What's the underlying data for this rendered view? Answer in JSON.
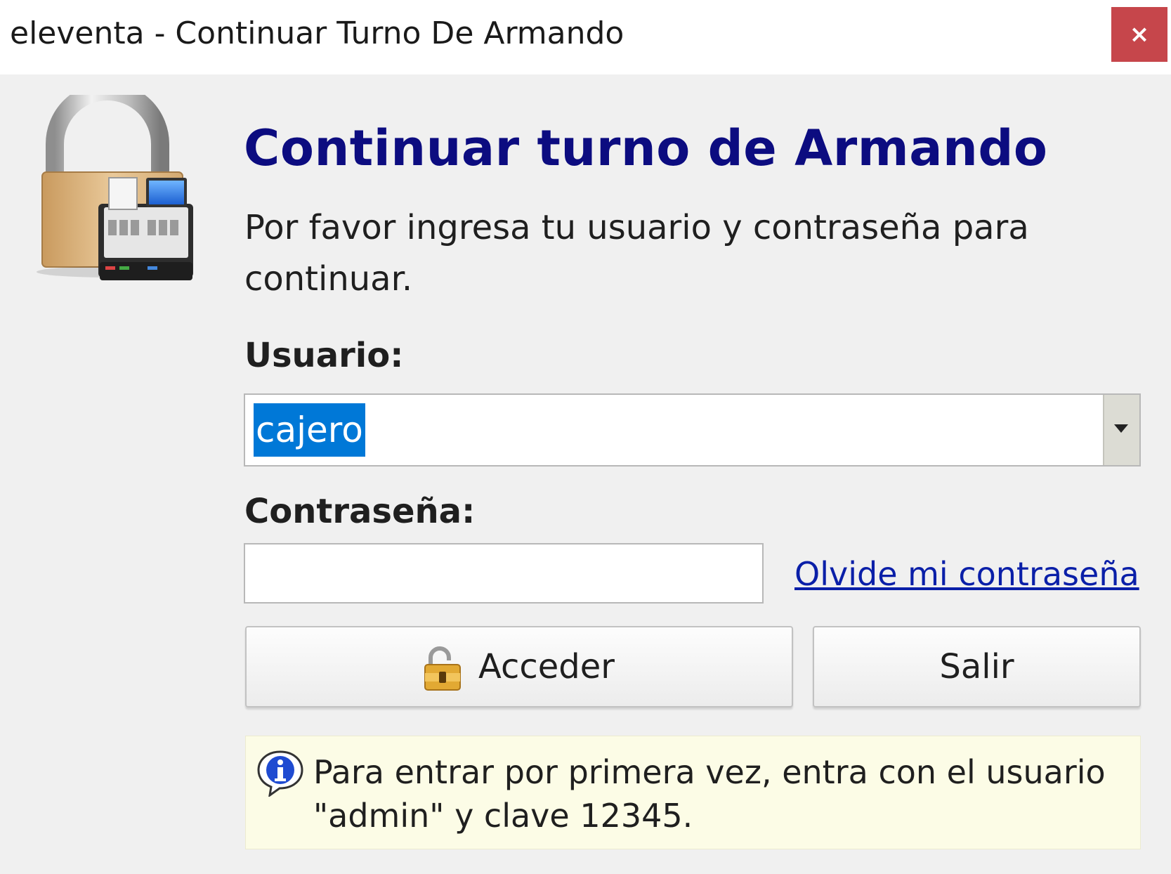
{
  "window": {
    "title": "eleventa - Continuar Turno De Armando",
    "close_glyph": "×"
  },
  "dialog": {
    "heading": "Continuar turno de Armando",
    "subtitle": "Por favor ingresa tu usuario y contraseña para continuar.",
    "lock_icon": "padlock-cash-register-icon"
  },
  "form": {
    "user_label": "Usuario:",
    "user_value": "cajero",
    "password_label": "Contraseña:",
    "password_value": "",
    "forgot_link": "Olvide mi contraseña"
  },
  "buttons": {
    "login_label": "Acceder",
    "login_icon": "unlocked-padlock-icon",
    "exit_label": "Salir"
  },
  "info": {
    "icon": "info-bubble-icon",
    "text": "Para entrar por primera vez, entra con el usuario \"admin\" y clave 12345."
  },
  "colors": {
    "heading": "#0c0c80",
    "link": "#0a1fa8",
    "selection": "#0078d7",
    "close_button": "#c6464b",
    "info_background": "#fcfce6"
  }
}
